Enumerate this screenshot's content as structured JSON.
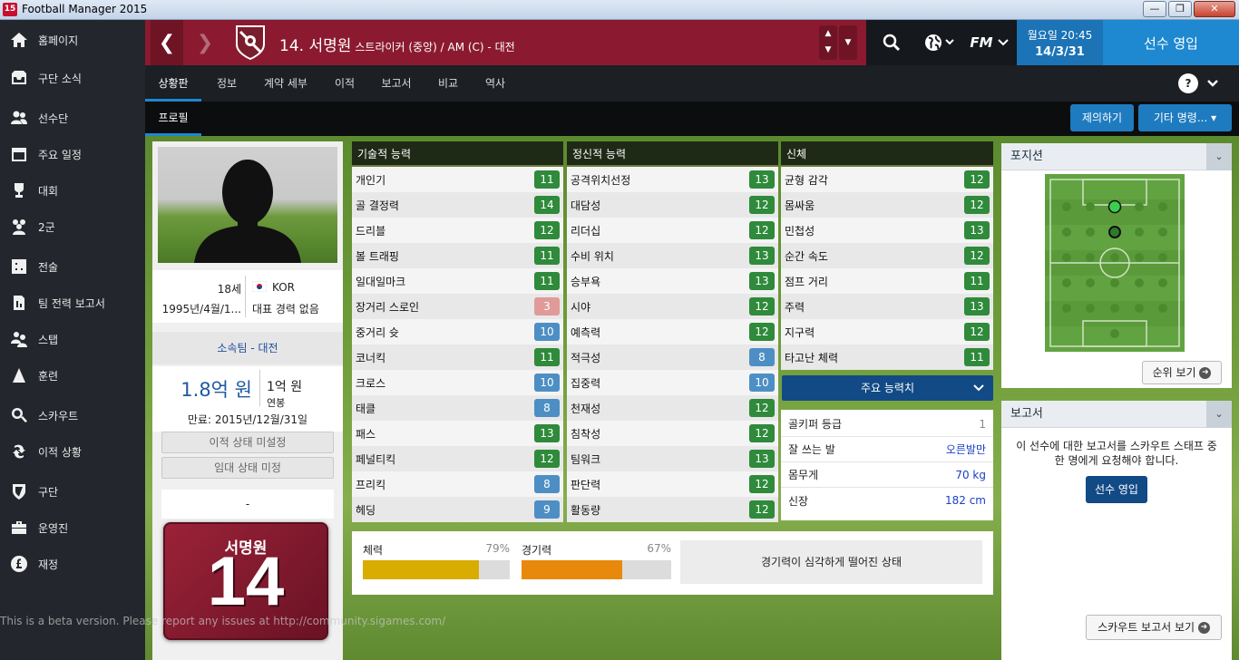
{
  "window": {
    "title": "Football Manager 2015",
    "app_badge": "15",
    "controls": {
      "minimize": "—",
      "restore": "❐",
      "close": "✕"
    }
  },
  "sidebar": {
    "items": [
      {
        "label": "홈페이지",
        "icon": "home-icon"
      },
      {
        "label": "구단 소식",
        "icon": "inbox-icon"
      },
      {
        "label": "선수단",
        "icon": "squad-icon"
      },
      {
        "label": "주요 일정",
        "icon": "calendar-icon"
      },
      {
        "label": "대회",
        "icon": "trophy-icon"
      },
      {
        "label": "2군",
        "icon": "reserves-icon"
      },
      {
        "label": "전술",
        "icon": "tactics-icon"
      },
      {
        "label": "팀 전력 보고서",
        "icon": "report-icon"
      },
      {
        "label": "스탭",
        "icon": "staff-icon"
      },
      {
        "label": "훈련",
        "icon": "training-icon"
      },
      {
        "label": "스카우트",
        "icon": "search-icon"
      },
      {
        "label": "이적 상황",
        "icon": "transfer-icon"
      },
      {
        "label": "구단",
        "icon": "club-shield-icon"
      },
      {
        "label": "운영진",
        "icon": "board-icon"
      },
      {
        "label": "재정",
        "icon": "finance-icon"
      }
    ]
  },
  "header": {
    "player_title": "14. 서명원",
    "player_sub": "스트라이커 (중앙) / AM (C) - 대전",
    "back": "❮",
    "forward": "❯",
    "stepper_up": "▲",
    "stepper_down": "▼",
    "dropdown": "▼",
    "date_line1": "월요일 20:45",
    "date_line2": "14/3/31",
    "continue_label": "선수 영입",
    "fm_label": "FM",
    "help_label": "?",
    "accent": "#8b1a30"
  },
  "tabs": [
    "상황판",
    "정보",
    "계약 세부",
    "이적",
    "보고서",
    "비교",
    "역사"
  ],
  "subtabs": {
    "profile": "프로필",
    "propose": "제의하기",
    "other": "기타 명령...",
    "other_caret": "▾"
  },
  "profile": {
    "age": "18세",
    "dob": "1995년/4월/1...",
    "nation": "KOR",
    "intl": "대표 경력 없음",
    "club": "소속팀 - 대전",
    "value": "1.8억 원",
    "wage": "1억 원",
    "wage_unit": "연봉",
    "expiry": "만료: 2015년/12월/31일",
    "transfer_status": "이적 상태 미설정",
    "loan_status": "임대 상태 미정",
    "dash": "-",
    "shirt_name": "서명원",
    "shirt_number": "14"
  },
  "technical": {
    "title": "기술적 능력",
    "rows": [
      {
        "name": "개인기",
        "value": "11",
        "tier": "green"
      },
      {
        "name": "골 결정력",
        "value": "14",
        "tier": "green"
      },
      {
        "name": "드리블",
        "value": "12",
        "tier": "green"
      },
      {
        "name": "볼 트래핑",
        "value": "11",
        "tier": "green"
      },
      {
        "name": "일대일마크",
        "value": "11",
        "tier": "green"
      },
      {
        "name": "장거리 스로인",
        "value": "3",
        "tier": "red"
      },
      {
        "name": "중거리 슛",
        "value": "10",
        "tier": "blue"
      },
      {
        "name": "코너킥",
        "value": "11",
        "tier": "green"
      },
      {
        "name": "크로스",
        "value": "10",
        "tier": "blue"
      },
      {
        "name": "태클",
        "value": "8",
        "tier": "blue"
      },
      {
        "name": "패스",
        "value": "13",
        "tier": "green"
      },
      {
        "name": "페널티킥",
        "value": "12",
        "tier": "green"
      },
      {
        "name": "프리킥",
        "value": "8",
        "tier": "blue"
      },
      {
        "name": "헤딩",
        "value": "9",
        "tier": "blue"
      }
    ]
  },
  "mental": {
    "title": "정신적 능력",
    "rows": [
      {
        "name": "공격위치선정",
        "value": "13",
        "tier": "green"
      },
      {
        "name": "대담성",
        "value": "12",
        "tier": "green"
      },
      {
        "name": "리더십",
        "value": "12",
        "tier": "green"
      },
      {
        "name": "수비 위치",
        "value": "13",
        "tier": "green"
      },
      {
        "name": "승부욕",
        "value": "13",
        "tier": "green"
      },
      {
        "name": "시야",
        "value": "12",
        "tier": "green"
      },
      {
        "name": "예측력",
        "value": "12",
        "tier": "green"
      },
      {
        "name": "적극성",
        "value": "8",
        "tier": "blue"
      },
      {
        "name": "집중력",
        "value": "10",
        "tier": "blue"
      },
      {
        "name": "천재성",
        "value": "12",
        "tier": "green"
      },
      {
        "name": "침착성",
        "value": "12",
        "tier": "green"
      },
      {
        "name": "팀워크",
        "value": "13",
        "tier": "green"
      },
      {
        "name": "판단력",
        "value": "12",
        "tier": "green"
      },
      {
        "name": "활동량",
        "value": "12",
        "tier": "green"
      }
    ]
  },
  "physical": {
    "title": "신체",
    "rows": [
      {
        "name": "균형 감각",
        "value": "12",
        "tier": "green"
      },
      {
        "name": "몸싸움",
        "value": "12",
        "tier": "green"
      },
      {
        "name": "민첩성",
        "value": "13",
        "tier": "green"
      },
      {
        "name": "순간 속도",
        "value": "12",
        "tier": "green"
      },
      {
        "name": "점프 거리",
        "value": "11",
        "tier": "green"
      },
      {
        "name": "주력",
        "value": "13",
        "tier": "green"
      },
      {
        "name": "지구력",
        "value": "12",
        "tier": "green"
      },
      {
        "name": "타고난 체력",
        "value": "11",
        "tier": "green"
      }
    ]
  },
  "key_attrs": {
    "label": "주요 능력치",
    "caret": "⌄"
  },
  "physical_info": [
    {
      "label": "골키퍼 등급",
      "value": "1"
    },
    {
      "label": "잘 쓰는 발",
      "value": "오른발만"
    },
    {
      "label": "몸무게",
      "value": "70 kg"
    },
    {
      "label": "신장",
      "value": "182 cm"
    }
  ],
  "condition": {
    "label": "체력",
    "percent": "79%",
    "level": 0.79,
    "color": "#d9ac00"
  },
  "sharpness": {
    "label": "경기력",
    "percent": "67%",
    "level": 0.67,
    "color": "#e8890b"
  },
  "status_note": "경기력이 심각하게 떨어진 상태",
  "position_panel": {
    "title": "포지션",
    "rank_btn": "순위 보기"
  },
  "report_panel": {
    "title": "보고서",
    "text": "이 선수에 대한 보고서를 스카우트 스태프 중 한 명에게 요청해야 합니다.",
    "sign_btn": "선수 영입",
    "scout_btn": "스카우트 보고서 보기"
  },
  "beta_text": "This is a beta version. Please report any issues at http://community.sigames.com/"
}
